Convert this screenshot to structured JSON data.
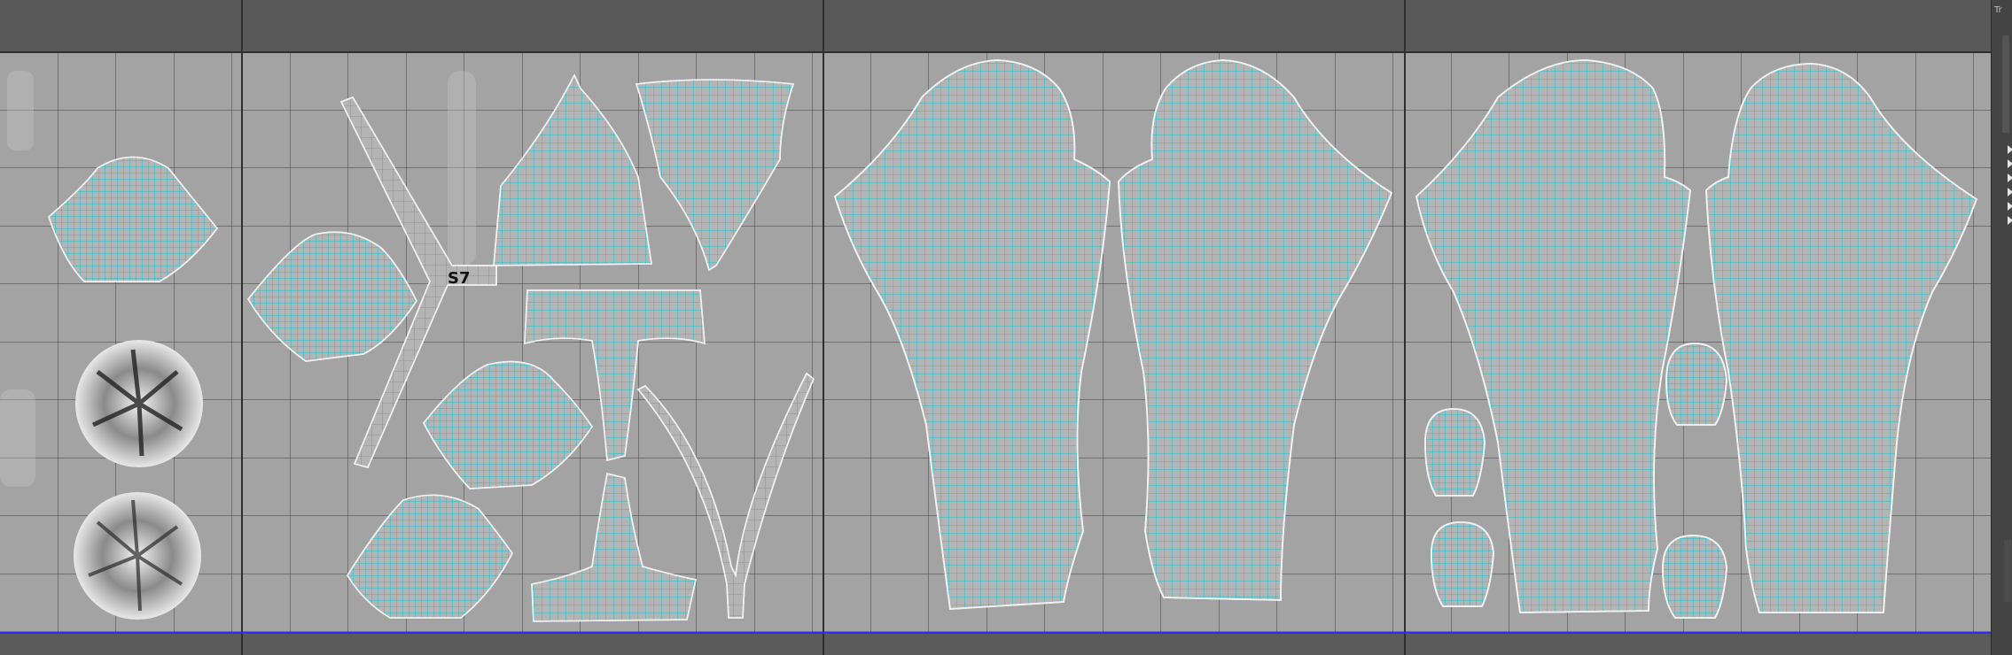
{
  "side_panel": {
    "label": "Tr",
    "expander_arrows": [
      "collapsed",
      "collapsed",
      "collapsed",
      "collapsed",
      "collapsed",
      "collapsed"
    ]
  },
  "colors": {
    "viewport_bg": "#585858",
    "uv_tile": "#a3a3a3",
    "grid_line": "#3a3a3a",
    "uv_shell_fill": "#b4b4b4",
    "uv_wire": "#10c8d6",
    "uv_border": "#f2f2f2",
    "baseline": "#2b2bff"
  },
  "icons": [
    "expand-arrow-icon"
  ]
}
